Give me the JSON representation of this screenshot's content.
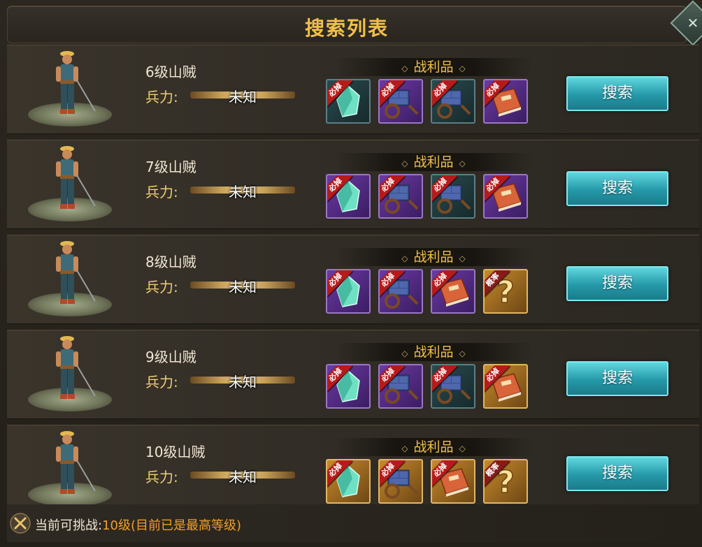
{
  "title": "搜索列表",
  "force_label": "兵力:",
  "loot_label": "战利品",
  "search_label": "搜索",
  "badge_must": "必掉",
  "badge_prob": "概率",
  "rows": [
    {
      "name": "6级山贼",
      "force": "未知",
      "items": [
        {
          "icon": "crystal-icon",
          "frame": "dark",
          "badge": "必掉"
        },
        {
          "icon": "supply-cart-icon",
          "frame": "purple",
          "badge": "必掉"
        },
        {
          "icon": "supply-cart-icon",
          "frame": "dark",
          "badge": "必掉"
        },
        {
          "icon": "book-icon",
          "frame": "purple",
          "badge": "必掉"
        }
      ]
    },
    {
      "name": "7级山贼",
      "force": "未知",
      "items": [
        {
          "icon": "crystal-icon",
          "frame": "purple",
          "badge": "必掉"
        },
        {
          "icon": "supply-cart-icon",
          "frame": "purple",
          "badge": "必掉"
        },
        {
          "icon": "supply-cart-icon",
          "frame": "dark",
          "badge": "必掉"
        },
        {
          "icon": "book-icon",
          "frame": "purple",
          "badge": "必掉"
        }
      ]
    },
    {
      "name": "8级山贼",
      "force": "未知",
      "items": [
        {
          "icon": "crystal-icon",
          "frame": "purple",
          "badge": "必掉"
        },
        {
          "icon": "supply-cart-icon",
          "frame": "purple",
          "badge": "必掉"
        },
        {
          "icon": "book-icon",
          "frame": "purple",
          "badge": "必掉"
        },
        {
          "icon": "question-mark-icon",
          "frame": "gold",
          "badge": "概率"
        }
      ]
    },
    {
      "name": "9级山贼",
      "force": "未知",
      "items": [
        {
          "icon": "crystal-icon",
          "frame": "purple",
          "badge": "必掉"
        },
        {
          "icon": "supply-cart-icon",
          "frame": "purple",
          "badge": "必掉"
        },
        {
          "icon": "supply-cart-icon",
          "frame": "dark",
          "badge": "必掉"
        },
        {
          "icon": "book-icon",
          "frame": "gold",
          "badge": "必掉"
        }
      ]
    },
    {
      "name": "10级山贼",
      "force": "未知",
      "items": [
        {
          "icon": "crystal-icon",
          "frame": "gold",
          "badge": "必掉"
        },
        {
          "icon": "supply-cart-icon",
          "frame": "gold",
          "badge": "必掉"
        },
        {
          "icon": "book-icon",
          "frame": "gold",
          "badge": "必掉"
        },
        {
          "icon": "question-mark-icon",
          "frame": "gold",
          "badge": "概率"
        }
      ]
    }
  ],
  "footer": {
    "label": "当前可挑战:",
    "value": "10级(目前已是最高等级)"
  },
  "colors": {
    "title": "#f0c04a",
    "accent": "#f0a02a",
    "button": "#2598a8"
  }
}
